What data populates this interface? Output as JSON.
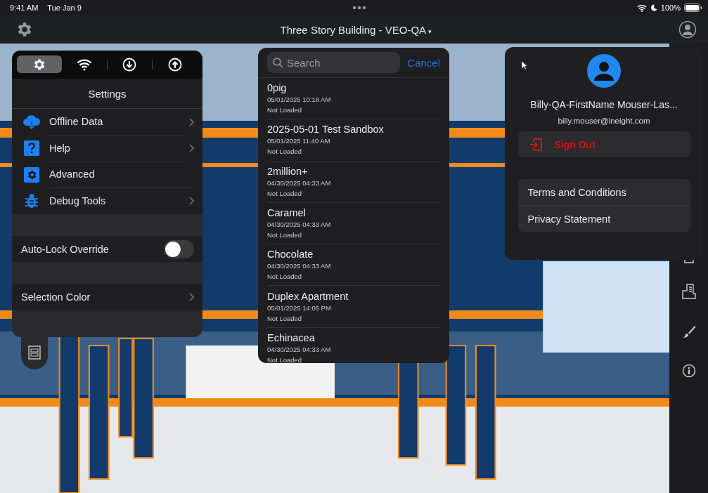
{
  "status_bar": {
    "time": "9:41 AM",
    "date": "Tue Jan 9",
    "battery": "100%"
  },
  "nav_bar": {
    "title": "Three Story Building - VEO-QA",
    "title_caret": "▾"
  },
  "settings_popover": {
    "tabs": [
      {
        "kind": "gear",
        "selected": true
      },
      {
        "kind": "wifi",
        "selected": false
      },
      {
        "kind": "download",
        "selected": false
      },
      {
        "kind": "upload",
        "selected": false
      }
    ],
    "title": "Settings",
    "items": [
      {
        "kind": "cloud",
        "label": "Offline Data",
        "chevron": true
      },
      {
        "kind": "help",
        "label": "Help",
        "chevron": true
      },
      {
        "kind": "advanced",
        "label": "Advanced",
        "chevron": false
      },
      {
        "kind": "bug",
        "label": "Debug Tools",
        "chevron": true
      }
    ],
    "auto_lock": {
      "label": "Auto-Lock Override",
      "on": false
    },
    "selection_color": {
      "label": "Selection Color",
      "chevron": true
    }
  },
  "project_popover": {
    "search": {
      "placeholder": "Search"
    },
    "cancel": "Cancel",
    "projects": [
      {
        "name": "0pig",
        "date": "05/01/2025 10:18 AM",
        "status": "Not Loaded"
      },
      {
        "name": "2025-05-01 Test Sandbox",
        "date": "05/01/2025 11:40 AM",
        "status": "Not Loaded"
      },
      {
        "name": "2million+",
        "date": "04/30/2025 04:33 AM",
        "status": "Not Loaded"
      },
      {
        "name": "Caramel",
        "date": "04/30/2025 04:33 AM",
        "status": "Not Loaded"
      },
      {
        "name": "Chocolate",
        "date": "04/30/2025 04:33 AM",
        "status": "Not Loaded"
      },
      {
        "name": "Duplex Apartment",
        "date": "05/01/2025 14:05 PM",
        "status": "Not Loaded"
      },
      {
        "name": "Echinacea",
        "date": "04/30/2025 04:33 AM",
        "status": "Not Loaded"
      }
    ]
  },
  "account_popover": {
    "name": "Billy-QA-FirstName Mouser-Las...",
    "email": "billy.mouser@ineight.com",
    "sign_out": "Sign Out",
    "links": [
      "Terms and Conditions",
      "Privacy Statement"
    ]
  }
}
